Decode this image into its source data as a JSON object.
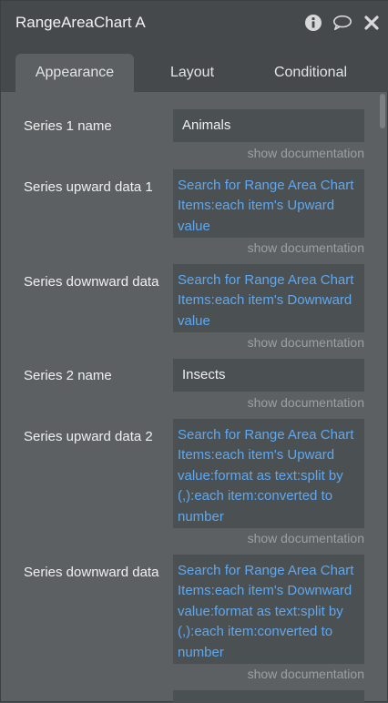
{
  "window": {
    "title": "RangeAreaChart A",
    "icons": [
      "info-icon",
      "comment-icon",
      "close-icon"
    ]
  },
  "tabs": [
    {
      "label": "Appearance",
      "active": true
    },
    {
      "label": "Layout",
      "active": false
    },
    {
      "label": "Conditional",
      "active": false
    }
  ],
  "doc_link": "show documentation",
  "properties": [
    {
      "label": "Series 1 name",
      "value": "Animals",
      "kind": "text"
    },
    {
      "label": "Series upward data 1",
      "value": "Search for Range Area Chart Items:each item's Upward value",
      "kind": "expression"
    },
    {
      "label": "Series downward data",
      "value": "Search for Range Area Chart Items:each item's Downward value",
      "kind": "expression"
    },
    {
      "label": "Series 2 name",
      "value": "Insects",
      "kind": "text"
    },
    {
      "label": "Series upward data 2",
      "value": "Search for Range Area Chart Items:each item's Upward value:format as text:split by (,):each item:converted to number",
      "kind": "expression"
    },
    {
      "label": "Series downward data",
      "value": "Search for Range Area Chart Items:each item's Downward value:format as text:split by (,):each item:converted to number",
      "kind": "expression"
    }
  ],
  "colors": {
    "panel_bg": "#5c6063",
    "header_bg": "#45494c",
    "field_bg": "#4b5053",
    "expression_text": "#5fa8f0",
    "doc_link": "#9aa0a3"
  }
}
